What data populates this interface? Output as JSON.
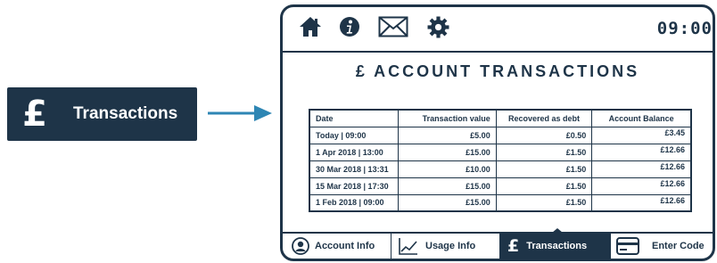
{
  "callout": {
    "icon": "pound-icon",
    "glyph": "£",
    "label": "Transactions"
  },
  "topbar": {
    "icons": [
      "home-icon",
      "info-icon",
      "mail-icon",
      "gear-icon"
    ],
    "time": "09:00"
  },
  "page": {
    "title": "£ ACCOUNT TRANSACTIONS"
  },
  "table": {
    "headers": [
      "Date",
      "Transaction value",
      "Recovered as debt",
      "Account Balance"
    ],
    "rows": [
      [
        "Today  | 09:00",
        "£5.00",
        "£0.50",
        "£3.45"
      ],
      [
        "1 Apr 2018  | 13:00",
        "£15.00",
        "£1.50",
        "£12.66"
      ],
      [
        "30 Mar 2018 | 13:31",
        "£10.00",
        "£1.50",
        "£12.66"
      ],
      [
        "15 Mar 2018 | 17:30",
        "£15.00",
        "£1.50",
        "£12.66"
      ],
      [
        "1 Feb 2018 | 09:00",
        "£15.00",
        "£1.50",
        "£12.66"
      ]
    ]
  },
  "bottomnav": {
    "tabs": [
      {
        "label": "Account Info",
        "icon": "user-icon"
      },
      {
        "label": "Usage Info",
        "icon": "chart-line-icon"
      },
      {
        "label": "Transactions",
        "icon": "pound-icon",
        "active": true
      },
      {
        "label": "Enter Code",
        "icon": "card-icon"
      }
    ]
  },
  "colors": {
    "navy": "#1e3448",
    "accent": "#2e86b4"
  }
}
